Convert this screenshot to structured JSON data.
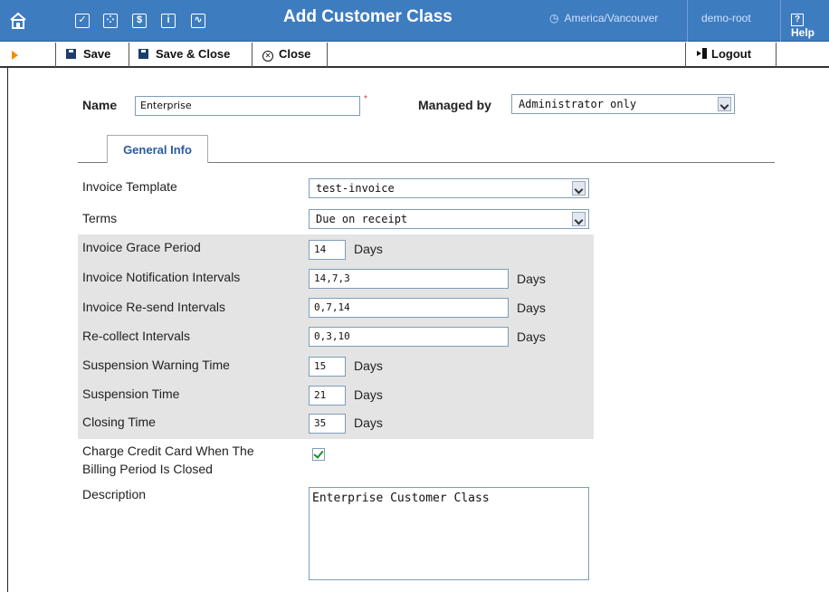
{
  "header": {
    "title": "Add Customer Class",
    "timezone": "America/Vancouver",
    "user": "demo-root",
    "help": "Help"
  },
  "toolbar": {
    "save": "Save",
    "save_close": "Save & Close",
    "close": "Close",
    "logout": "Logout"
  },
  "form": {
    "name_label": "Name",
    "name_value": "Enterprise",
    "managed_by_label": "Managed by",
    "managed_by_value": "Administrator only",
    "tab_label": "General Info",
    "invoice_template_label": "Invoice Template",
    "invoice_template_value": "test-invoice",
    "terms_label": "Terms",
    "terms_value": "Due on receipt",
    "grace_label": "Invoice Grace Period",
    "grace_value": "14",
    "notif_label": "Invoice Notification Intervals",
    "notif_value": "14,7,3",
    "resend_label": "Invoice Re-send Intervals",
    "resend_value": "0,7,14",
    "recollect_label": "Re-collect Intervals",
    "recollect_value": "0,3,10",
    "susp_warn_label": "Suspension Warning Time",
    "susp_warn_value": "15",
    "susp_label": "Suspension Time",
    "susp_value": "21",
    "closing_label": "Closing Time",
    "closing_value": "35",
    "days": "Days",
    "charge_label_1": "Charge Credit Card When The",
    "charge_label_2": "Billing Period Is Closed",
    "charge_checked": true,
    "description_label": "Description",
    "description_value": "Enterprise Customer Class"
  }
}
